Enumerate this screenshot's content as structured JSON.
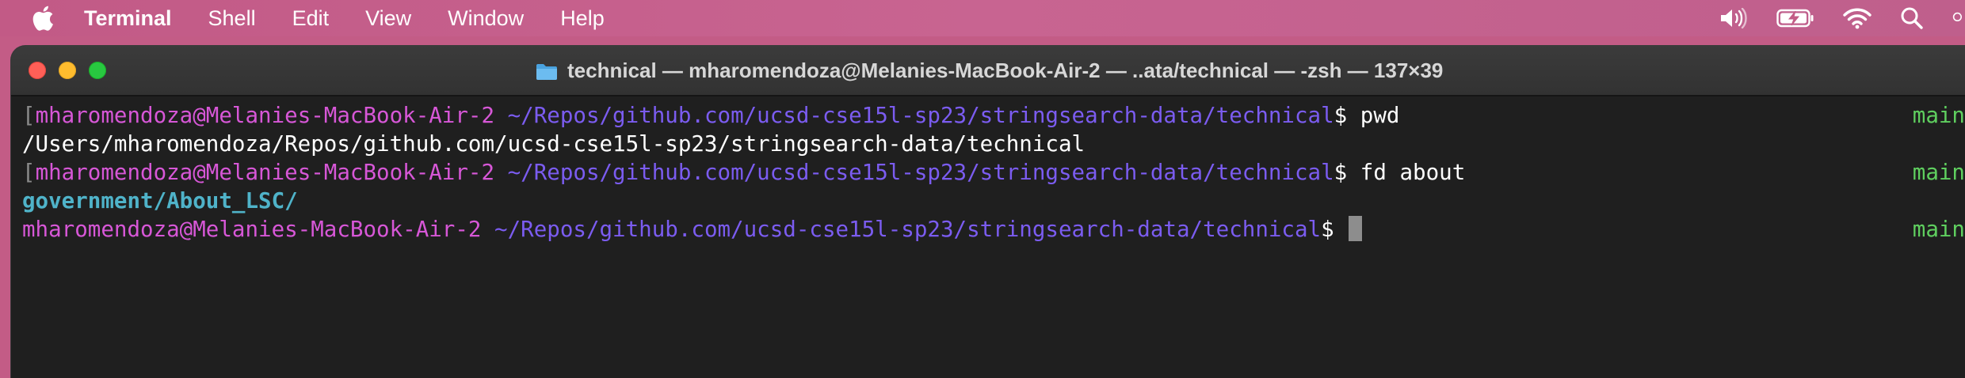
{
  "menubar": {
    "apple_icon": "apple-logo-icon",
    "app_name": "Terminal",
    "items": [
      "Shell",
      "Edit",
      "View",
      "Window",
      "Help"
    ],
    "status_icons": [
      "volume-icon",
      "battery-charging-icon",
      "wifi-icon",
      "search-icon"
    ]
  },
  "window": {
    "title": "technical — mharomendoza@Melanies-MacBook-Air-2 — ..ata/technical — -zsh — 137×39",
    "folder_icon": "folder-icon"
  },
  "terminal": {
    "lines": [
      {
        "user_host": "mharomendoza@Melanies-MacBook-Air-2",
        "path": "~/Repos/github.com/ucsd-cse15l-sp23/stringsearch-data/technical",
        "prompt": "$",
        "command": "pwd",
        "branch": "main"
      },
      {
        "output": "/Users/mharomendoza/Repos/github.com/ucsd-cse15l-sp23/stringsearch-data/technical"
      },
      {
        "user_host": "mharomendoza@Melanies-MacBook-Air-2",
        "path": "~/Repos/github.com/ucsd-cse15l-sp23/stringsearch-data/technical",
        "prompt": "$",
        "command": "fd about",
        "branch": "main"
      },
      {
        "output": "government/About_LSC/"
      },
      {
        "user_host": "mharomendoza@Melanies-MacBook-Air-2",
        "path": "~/Repos/github.com/ucsd-cse15l-sp23/stringsearch-data/technical",
        "prompt": "$",
        "command": "",
        "branch": "main"
      }
    ]
  },
  "colors": {
    "desktop": "#c35c86",
    "terminal_bg": "#1f1f1f",
    "user_host": "#d757d7",
    "path": "#7b5cf0",
    "branch": "#5fcf5f",
    "dir_output": "#4fb3c9"
  }
}
